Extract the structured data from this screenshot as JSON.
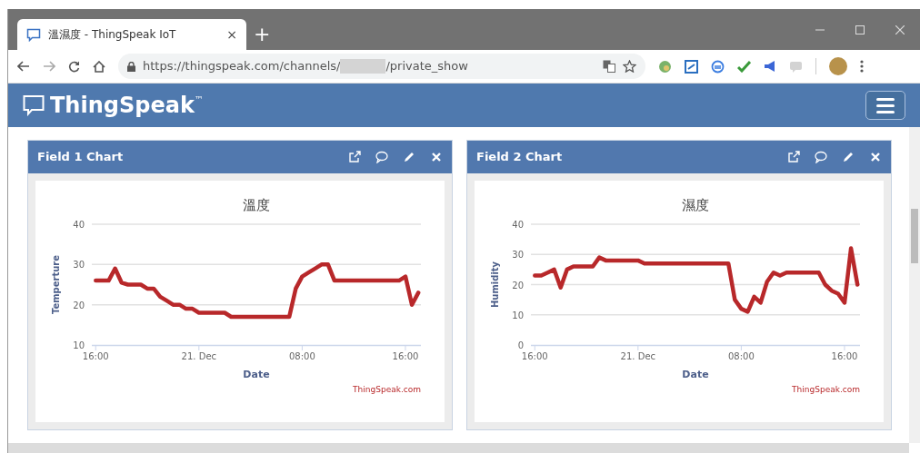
{
  "browser": {
    "tab_title": "溫濕度 - ThingSpeak IoT",
    "tab_close": "×",
    "new_tab": "+",
    "url_start": "https://thingspeak.com/channels/",
    "url_end": "/private_show"
  },
  "navbar": {
    "brand": "ThingSpeak$^{™}$"
  },
  "panels": [
    {
      "title": "Field 1 Chart",
      "credit": "ThingSpeak.com",
      "chart_data": {
        "type": "line",
        "title": "溫度",
        "xlabel": "Date",
        "ylabel": "Temperture",
        "grid": true,
        "ylim": [
          10,
          40
        ],
        "yticks": [
          10,
          20,
          30,
          40
        ],
        "categories": [
          "16:00",
          null,
          null,
          null,
          null,
          null,
          null,
          null,
          null,
          null,
          null,
          null,
          null,
          null,
          null,
          null,
          "21. Dec",
          null,
          null,
          null,
          null,
          null,
          null,
          null,
          null,
          null,
          null,
          null,
          null,
          null,
          null,
          null,
          "08:00",
          null,
          null,
          null,
          null,
          null,
          null,
          null,
          null,
          null,
          null,
          null,
          null,
          null,
          null,
          null,
          "16:00",
          null,
          null
        ],
        "series": [
          {
            "color": "#b8282a",
            "values": [
              26,
              26,
              26,
              29,
              25.5,
              25,
              25,
              25,
              24,
              24,
              22,
              21,
              20,
              20,
              19,
              19,
              18,
              18,
              18,
              18,
              18,
              17,
              17,
              17,
              17,
              17,
              17,
              17,
              17,
              17,
              17,
              24,
              27,
              28,
              29,
              30,
              30,
              26,
              26,
              26,
              26,
              26,
              26,
              26,
              26,
              26,
              26,
              26,
              27,
              20,
              23
            ]
          }
        ]
      }
    },
    {
      "title": "Field 2 Chart",
      "credit": "ThingSpeak.com",
      "chart_data": {
        "type": "line",
        "title": "濕度",
        "xlabel": "Date",
        "ylabel": "Humidity",
        "grid": true,
        "ylim": [
          0,
          40
        ],
        "yticks": [
          0,
          10,
          20,
          30,
          40
        ],
        "categories": [
          "16:00",
          null,
          null,
          null,
          null,
          null,
          null,
          null,
          null,
          null,
          null,
          null,
          null,
          null,
          null,
          null,
          "21. Dec",
          null,
          null,
          null,
          null,
          null,
          null,
          null,
          null,
          null,
          null,
          null,
          null,
          null,
          null,
          null,
          "08:00",
          null,
          null,
          null,
          null,
          null,
          null,
          null,
          null,
          null,
          null,
          null,
          null,
          null,
          null,
          null,
          "16:00",
          null,
          null
        ],
        "series": [
          {
            "color": "#b8282a",
            "values": [
              23,
              23,
              24,
              25,
              19,
              25,
              26,
              26,
              26,
              26,
              29,
              28,
              28,
              28,
              28,
              28,
              28,
              27,
              27,
              27,
              27,
              27,
              27,
              27,
              27,
              27,
              27,
              27,
              27,
              27,
              27,
              15,
              12,
              11,
              16,
              14,
              21,
              24,
              23,
              24,
              24,
              24,
              24,
              24,
              24,
              20,
              18,
              17,
              14,
              32,
              20
            ]
          }
        ]
      }
    }
  ]
}
